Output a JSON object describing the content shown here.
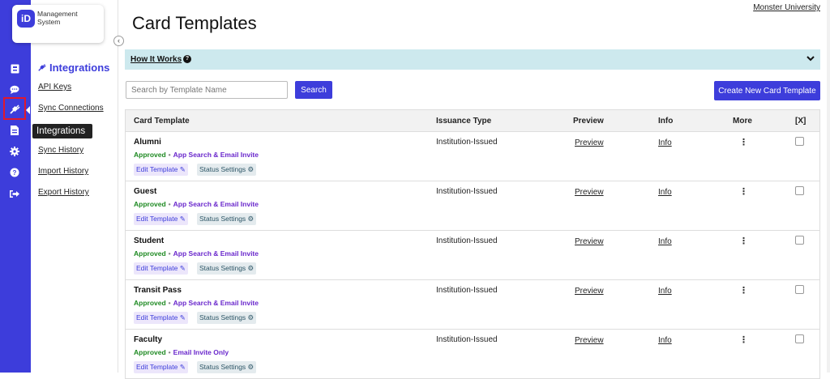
{
  "app": {
    "logo_mark": "iD",
    "logo_text": "Management System",
    "university_link": "Monster University"
  },
  "icon_rail": [
    {
      "name": "id-card-icon"
    },
    {
      "name": "chat-icon"
    },
    {
      "name": "integrations-plug-icon",
      "active": true
    },
    {
      "name": "document-icon"
    },
    {
      "name": "gear-icon"
    },
    {
      "name": "help-icon"
    },
    {
      "name": "sign-out-icon"
    }
  ],
  "nav": {
    "heading": "Integrations",
    "links": [
      "API Keys",
      "Sync Connections",
      "Sync History",
      "Import History",
      "Export History"
    ]
  },
  "tooltip": "Integrations",
  "page": {
    "title": "Card Templates",
    "how_it_works": "How It Works"
  },
  "search": {
    "placeholder": "Search by Template Name",
    "button": "Search"
  },
  "create_button": "Create New Card Template",
  "table": {
    "headers": {
      "template": "Card Template",
      "issuance": "Issuance Type",
      "preview": "Preview",
      "info": "Info",
      "more": "More",
      "select": "[X]"
    },
    "rows": [
      {
        "name": "Alumni",
        "status": "Approved",
        "invite_type": "App Search & Email Invite",
        "issuance": "Institution-Issued",
        "preview": "Preview",
        "info": "Info",
        "edit": "Edit Template",
        "status_settings": "Status Settings",
        "checked": false
      },
      {
        "name": "Guest",
        "status": "Approved",
        "invite_type": "App Search & Email Invite",
        "issuance": "Institution-Issued",
        "preview": "Preview",
        "info": "Info",
        "edit": "Edit Template",
        "status_settings": "Status Settings",
        "checked": false
      },
      {
        "name": "Student",
        "status": "Approved",
        "invite_type": "App Search & Email Invite",
        "issuance": "Institution-Issued",
        "preview": "Preview",
        "info": "Info",
        "edit": "Edit Template",
        "status_settings": "Status Settings",
        "checked": false
      },
      {
        "name": "Transit Pass",
        "status": "Approved",
        "invite_type": "App Search & Email Invite",
        "issuance": "Institution-Issued",
        "preview": "Preview",
        "info": "Info",
        "edit": "Edit Template",
        "status_settings": "Status Settings",
        "checked": false
      },
      {
        "name": "Faculty",
        "status": "Approved",
        "invite_type": "Email Invite Only",
        "issuance": "Institution-Issued",
        "preview": "Preview",
        "info": "Info",
        "edit": "Edit Template",
        "status_settings": "Status Settings",
        "checked": false
      }
    ]
  },
  "colors": {
    "brand": "#3d3ddb",
    "approved": "#1e8a22",
    "invite": "#6a28cc",
    "info_bar": "#cde9ee",
    "active_outline": "#e0182d"
  }
}
